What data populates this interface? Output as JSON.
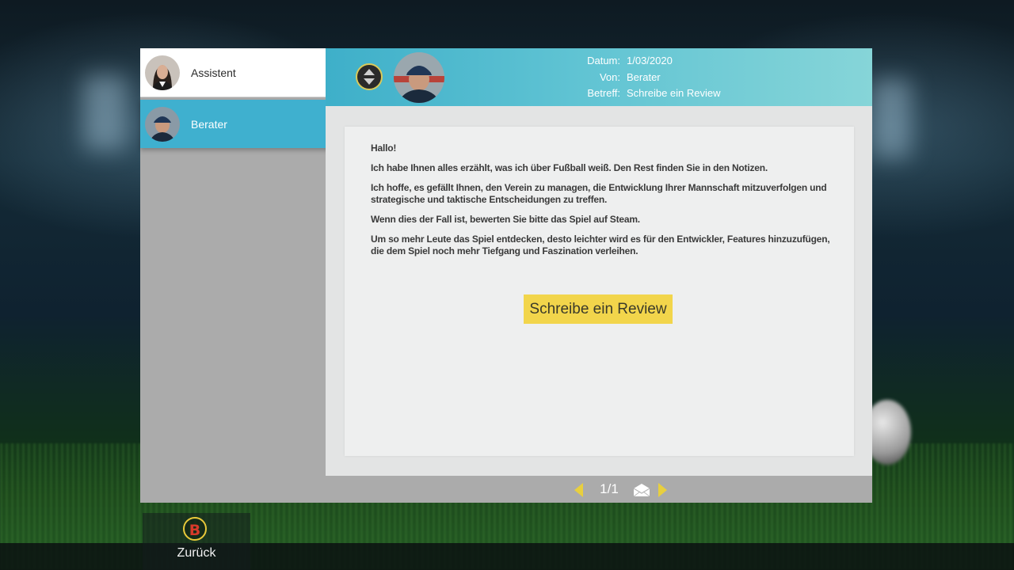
{
  "sidebar": {
    "contacts": [
      {
        "label": "Assistent",
        "selected": false
      },
      {
        "label": "Berater",
        "selected": true
      }
    ]
  },
  "header": {
    "fields": [
      {
        "key": "Datum:",
        "value": "1/03/2020"
      },
      {
        "key": "Von:",
        "value": "Berater"
      },
      {
        "key": "Betreff:",
        "value": "Schreibe ein Review"
      }
    ]
  },
  "letter": {
    "paragraphs": [
      "Hallo!",
      "Ich habe Ihnen alles erzählt, was ich über Fußball weiß. Den Rest finden Sie in den Notizen.",
      "Ich hoffe, es gefällt Ihnen, den Verein zu managen, die Entwicklung Ihrer Mannschaft mitzuverfolgen und strategische und taktische Entscheidungen zu treffen.",
      "Wenn dies der Fall ist, bewerten Sie bitte das Spiel auf Steam.",
      "Um so mehr Leute das Spiel entdecken, desto leichter wird es für den Entwickler, Features hinzuzufügen, die dem Spiel noch mehr Tiefgang und Faszination verleihen."
    ],
    "review_button": "Schreibe ein Review"
  },
  "pager": {
    "count": "1/1"
  },
  "footer": {
    "back_key": "B",
    "back_label": "Zurück"
  },
  "colors": {
    "accent": "#3fb0cf",
    "highlight": "#f2d54b",
    "arrow": "#e8cf3e"
  }
}
